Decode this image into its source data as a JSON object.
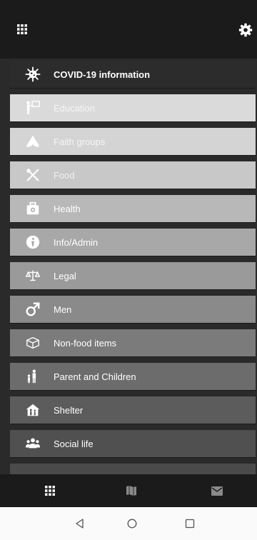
{
  "menu": {
    "items": [
      {
        "label": "COVID-19 information",
        "icon": "virus-icon"
      },
      {
        "label": "Education",
        "icon": "teacher-board-icon"
      },
      {
        "label": "Faith groups",
        "icon": "praying-hands-icon"
      },
      {
        "label": "Food",
        "icon": "utensils-icon"
      },
      {
        "label": "Health",
        "icon": "medical-kit-icon"
      },
      {
        "label": "Info/Admin",
        "icon": "info-icon"
      },
      {
        "label": "Legal",
        "icon": "scales-icon"
      },
      {
        "label": "Men",
        "icon": "male-symbol-icon"
      },
      {
        "label": "Non-food items",
        "icon": "box-icon"
      },
      {
        "label": "Parent and Children",
        "icon": "family-icon"
      },
      {
        "label": "Shelter",
        "icon": "house-people-icon"
      },
      {
        "label": "Social life",
        "icon": "group-icon"
      }
    ]
  },
  "bottom_nav": {
    "items": [
      {
        "icon": "grid-icon"
      },
      {
        "icon": "map-icon"
      },
      {
        "icon": "mail-icon"
      }
    ]
  },
  "colors": {
    "topbar": "#1b1b1b",
    "list_bg": "#2a2a2a",
    "system_bar": "#fafafa"
  }
}
